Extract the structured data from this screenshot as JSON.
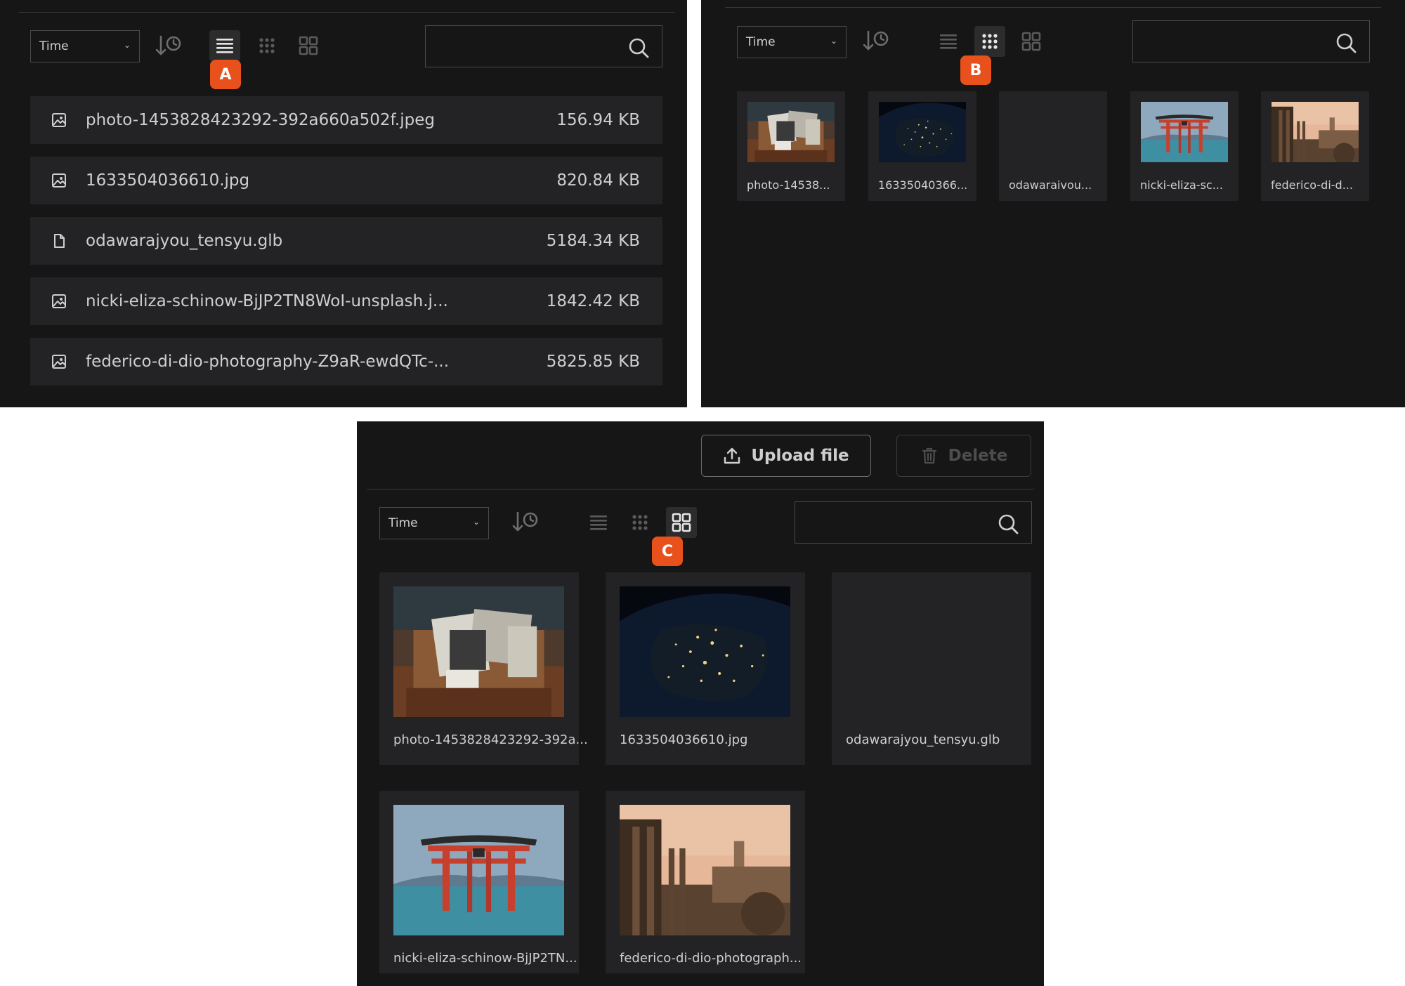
{
  "sort": {
    "label": "Time",
    "caret": "⌄"
  },
  "callouts": {
    "a": "A",
    "b": "B",
    "c": "C"
  },
  "colors": {
    "panel_bg": "#161616",
    "row_bg": "#232325",
    "badge": "#e8501c",
    "text": "#cfcfcf"
  },
  "files": [
    {
      "list_name": "photo-1453828423292-392a660a502f.jpeg",
      "size": "156.94 KB",
      "small_name": "photo-14538...",
      "large_name": "photo-1453828423292-392a...",
      "icon": "image-icon",
      "thumb": "vintage-photos-box"
    },
    {
      "list_name": "1633504036610.jpg",
      "size": "820.84 KB",
      "small_name": "16335040366...",
      "large_name": "1633504036610.jpg",
      "icon": "image-icon",
      "thumb": "earth-night-lights"
    },
    {
      "list_name": "odawarajyou_tensyu.glb",
      "size": "5184.34 KB",
      "small_name": "odawaraivou...",
      "large_name": "odawarajyou_tensyu.glb",
      "icon": "file-icon",
      "thumb": "none"
    },
    {
      "list_name": "nicki-eliza-schinow-BjJP2TN8WoI-unsplash.j...",
      "size": "1842.42 KB",
      "small_name": "nicki-eliza-sc...",
      "large_name": "nicki-eliza-schinow-BjJP2TN...",
      "icon": "image-icon",
      "thumb": "torii-gate"
    },
    {
      "list_name": "federico-di-dio-photography-Z9aR-ewdQTc-...",
      "size": "5825.85 KB",
      "small_name": "federico-di-d...",
      "large_name": "federico-di-dio-photograph...",
      "icon": "image-icon",
      "thumb": "roman-forum"
    }
  ],
  "toolbar": {
    "upload_label": "Upload file",
    "delete_label": "Delete"
  }
}
